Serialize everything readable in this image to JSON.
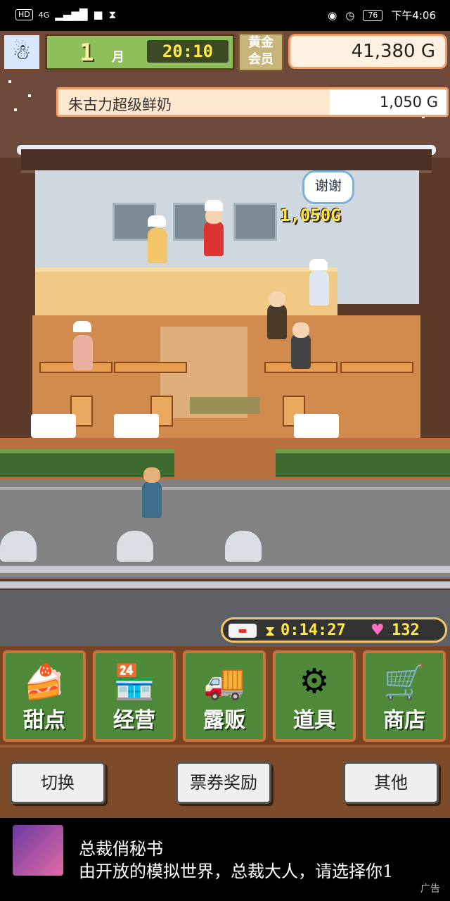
{
  "status_bar": {
    "hd": "HD",
    "network": "4G",
    "battery": "76",
    "time": "下午4:06"
  },
  "header": {
    "month_number": "1",
    "month_label": "月",
    "time": "20:10",
    "gold_member_label_1": "黄金",
    "gold_member_label_2": "会员",
    "money": "41,380 G"
  },
  "sale": {
    "item_name": "朱古力超级鲜奶",
    "price": "1,050 G"
  },
  "scene": {
    "speech": "谢谢",
    "earned": "1,050G"
  },
  "event_bar": {
    "timer": "0:14:27",
    "hearts": "132"
  },
  "menu": [
    {
      "label": "甜点",
      "icon": "cake-icon"
    },
    {
      "label": "经营",
      "icon": "shop-icon"
    },
    {
      "label": "露贩",
      "icon": "food-truck-icon"
    },
    {
      "label": "道具",
      "icon": "items-icon"
    },
    {
      "label": "商店",
      "icon": "cart-icon"
    }
  ],
  "actions": {
    "switch": "切换",
    "rewards": "票券奖励",
    "other": "其他"
  },
  "ad": {
    "title": "总裁俏秘书",
    "description": "由开放的模拟世界，总裁大人，请选择你1",
    "tag": "广告"
  }
}
